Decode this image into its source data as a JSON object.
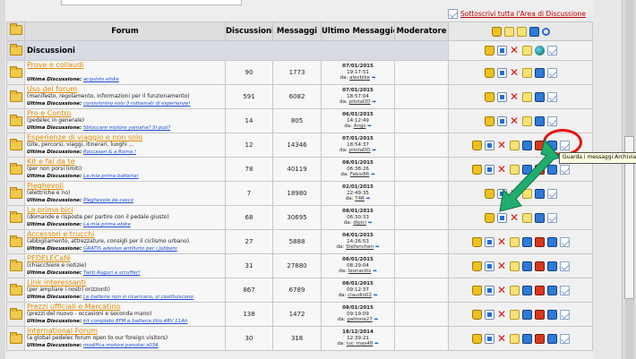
{
  "subscribe_link": "Sottoscrivi tutta l'Area di Discussione",
  "headers": {
    "forum": "Forum",
    "discussions": "Discussioni",
    "messages": "Messaggi",
    "last_message": "Ultimo Messaggio",
    "moderator": "Moderatore"
  },
  "category": {
    "name": "Discussioni"
  },
  "last_label": "Ultima Discussione:",
  "by_label": "da:",
  "tooltip": "Guarda i messaggi Archiviati",
  "forums": [
    {
      "title": "Prove e collaudi",
      "desc": "",
      "last_topic": "acquisto ebike",
      "discussions": "90",
      "messages": "1773",
      "date": "07/01/2015",
      "time": "19:17:51",
      "author": "alexbike"
    },
    {
      "title": "Uso del forum",
      "desc": "(manifesto, regolamento, informazioni per il funzionamento)",
      "last_topic": "corsivinnino solo 3 rottamati di esperienze!",
      "discussions": "591",
      "messages": "6082",
      "date": "07/01/2015",
      "time": "18:57:04",
      "author": "pilotaDD"
    },
    {
      "title": "Pro e Contro",
      "desc": "(pedelec in generale)",
      "last_topic": "Sbloccare motore yamaha? Si può?",
      "discussions": "14",
      "messages": "805",
      "date": "06/01/2015",
      "time": "14:12:49",
      "author": "Angs"
    },
    {
      "title": "Esperienze di viaggio e non solo",
      "desc": "Gite, percorsi, viaggi, itinerari, luoghi ...",
      "last_topic": "Roccasan & a Roma !",
      "discussions": "12",
      "messages": "14346",
      "date": "07/01/2015",
      "time": "18:54:37",
      "author": "pilotaDD"
    },
    {
      "title": "Kit e fai da te",
      "desc": "(per non porsi limiti)",
      "last_topic": "La mia prima batteria!",
      "discussions": "78",
      "messages": "40119",
      "date": "08/01/2015",
      "time": "06:38:26",
      "author": "Fabio86"
    },
    {
      "title": "Pieghevoli",
      "desc": "(elettriche e no)",
      "last_topic": "Pieghevole da casco",
      "discussions": "7",
      "messages": "18980",
      "date": "02/01/2015",
      "time": "22:49:35",
      "author": "T4R"
    },
    {
      "title": "La prima bici",
      "desc": "(domande e risposte per partire con il pedale giusto)",
      "last_topic": "La mia prima ebike",
      "discussions": "68",
      "messages": "30695",
      "date": "08/01/2015",
      "time": "06:30:33",
      "author": "dipici"
    },
    {
      "title": "Accessori e trucchi",
      "desc": "(abbigliamento, attrezzature, consigli per il ciclismo urbano)",
      "last_topic": "GRATIS adesivo antifurto per i Jobbers",
      "discussions": "27",
      "messages": "5888",
      "date": "04/01/2015",
      "time": "14:26:53",
      "author": "Stefanchen"
    },
    {
      "title": "PEDELECafé",
      "desc": "(chiacchiere e notizie)",
      "last_topic": "Tanti Auguri a scruffer!",
      "discussions": "31",
      "messages": "27880",
      "date": "08/01/2015",
      "time": "08:29:04",
      "author": "leonardix"
    },
    {
      "title": "Link interessanti",
      "desc": "(per ampliare i nostri orizzonti)",
      "last_topic": "Le batterie non si ricaricano, si costituiscono",
      "discussions": "867",
      "messages": "6789",
      "date": "08/01/2015",
      "time": "09:12:37",
      "author": "claudio02"
    },
    {
      "title": "Prezzi ufficiali e Mercatino",
      "desc": "(prezzi del nuovo - occasioni e seconda mano)",
      "last_topic": "kit completo 8FM e batteria litio 48V 11Ah",
      "discussions": "138",
      "messages": "1472",
      "date": "08/01/2015",
      "time": "09:19:09",
      "author": "gattone27"
    },
    {
      "title": "International Forum",
      "desc": "(a global pedelec forum open to our foreign visitors)",
      "last_topic": "modifica motore panotar s034",
      "discussions": "30",
      "messages": "318",
      "date": "18/12/2014",
      "time": "12:39:21",
      "author": "luc_mas48"
    }
  ],
  "colors": {
    "link": "#e08a00",
    "annotation": "#e81010",
    "arrow": "#1fae6e"
  }
}
